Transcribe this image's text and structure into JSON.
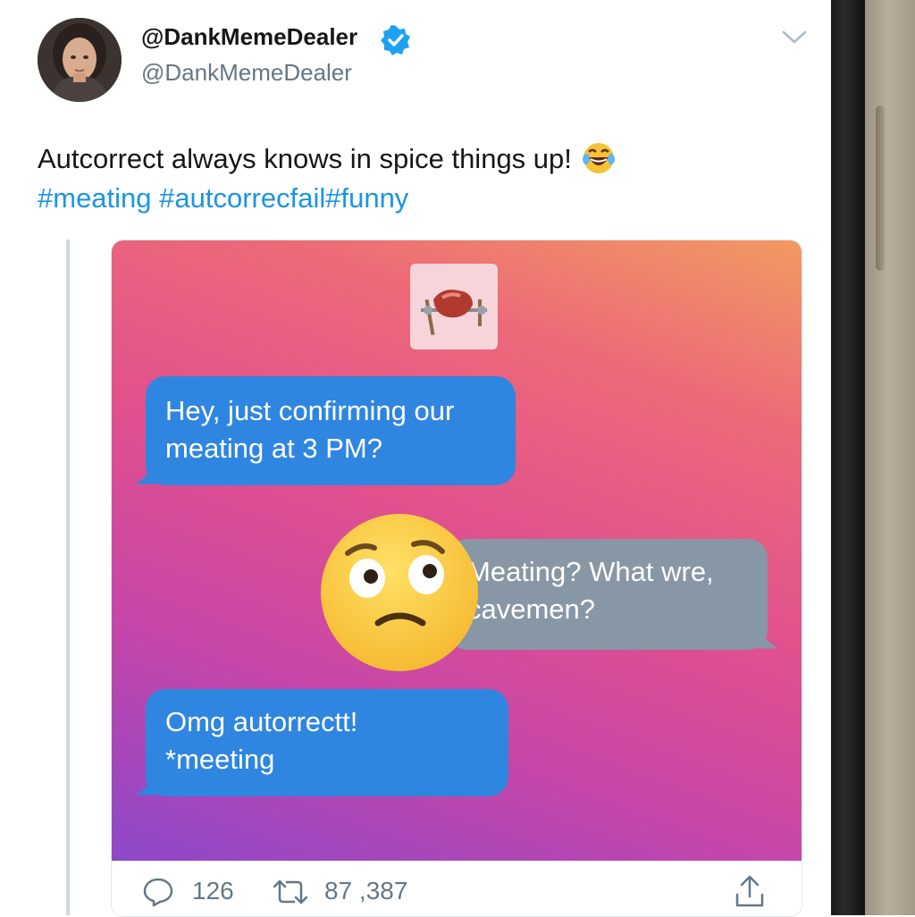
{
  "tweet": {
    "display_name": "@DankMemeDealer",
    "handle": "@DankMemeDealer",
    "verified": true,
    "text": "Autcorrect always knows in spice things up!",
    "hashtags": "#meating #autcorrecfail#funny",
    "text_emoji": "face-with-tears-of-joy-icon"
  },
  "media": {
    "messages": [
      {
        "line1": "Hey, just confirming our",
        "line2": "meating at 3 PM?",
        "sender": "me"
      },
      {
        "line1": "Meating? What wre,",
        "line2": "cavemen?",
        "sender": "them"
      },
      {
        "line1": "Omg autorrectt!",
        "line2": "*meeting",
        "sender": "me"
      }
    ],
    "top_icon": "meat-on-spit-icon",
    "reaction_emoji": "worried-face-icon"
  },
  "actions": {
    "reply_count": "126",
    "retweet_count": "87 ,387"
  },
  "colors": {
    "link": "#1b95e0",
    "bubble_blue": "#2f86e0",
    "bubble_gray": "#8797a6",
    "verified": "#1da1f2"
  }
}
